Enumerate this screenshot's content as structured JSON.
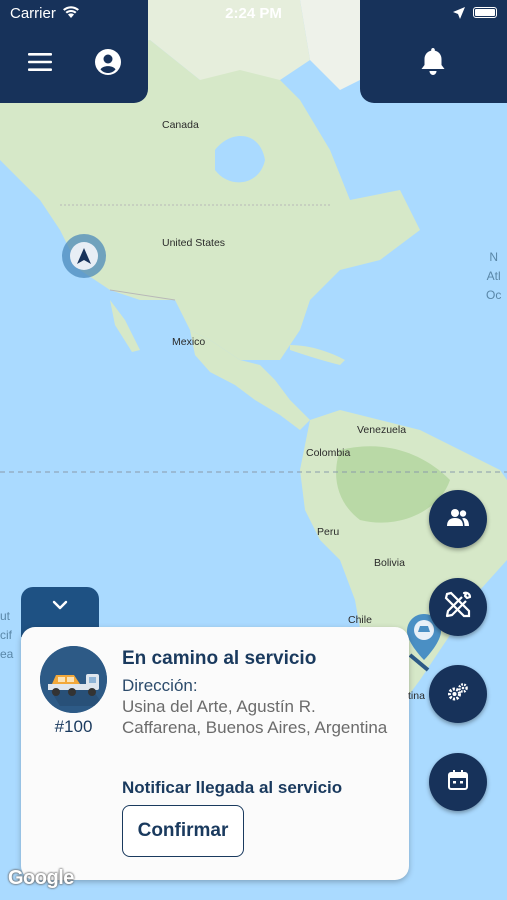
{
  "status_bar": {
    "carrier": "Carrier",
    "time": "2:24 PM"
  },
  "map": {
    "labels": {
      "canada": "Canada",
      "united_states": "United States",
      "mexico": "Mexico",
      "venezuela": "Venezuela",
      "colombia": "Colombia",
      "peru": "Peru",
      "bolivia": "Bolivia",
      "chile": "Chile",
      "argentina_partial": "tina",
      "north_atlantic_partial_1": "N",
      "north_atlantic_partial_2": "Atl",
      "north_atlantic_partial_3": "Oc",
      "south_pacific_partial_1": "ut",
      "south_pacific_partial_2": "cif",
      "south_pacific_partial_3": "ea"
    },
    "attribution": "Google"
  },
  "header": {
    "menu_icon": "hamburger-menu-icon",
    "profile_icon": "user-circle-icon",
    "notification_icon": "bell-icon"
  },
  "fabs": [
    "users-icon",
    "tools-icon",
    "gears-icon",
    "calendar-icon"
  ],
  "service_card": {
    "order_number": "#100",
    "title": "En camino al servicio",
    "address_label": "Dirección:",
    "address": "Usina del Arte, Agustín R. Caffarena, Buenos Aires, Argentina",
    "notify_label": "Notificar llegada al servicio",
    "confirm_button": "Confirmar"
  },
  "colors": {
    "primary": "#17325a",
    "tab": "#1e5183",
    "ocean": "#aadaff",
    "land": "#d6e8c8"
  }
}
